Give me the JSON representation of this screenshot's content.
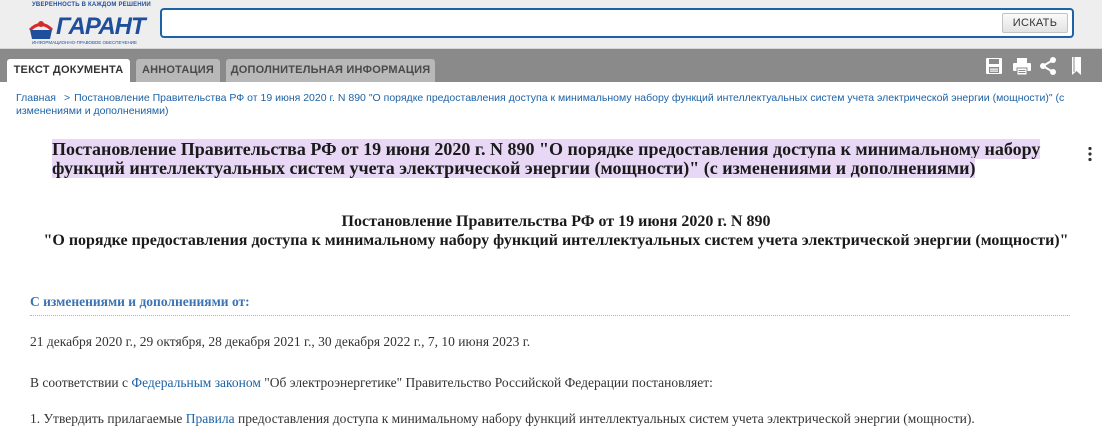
{
  "logo": {
    "tagline": "УВЕРЕННОСТЬ В КАЖДОМ РЕШЕНИИ",
    "wordmark": "ГАРАНТ",
    "subtitle": "ИНФОРМАЦИОННО-ПРАВОВОЕ ОБЕСПЕЧЕНИЕ"
  },
  "search": {
    "value": "",
    "placeholder": "",
    "button_label": "ИСКАТЬ"
  },
  "tabs": [
    {
      "label": "ТЕКСТ ДОКУМЕНТА",
      "active": true
    },
    {
      "label": "АННОТАЦИЯ",
      "active": false
    },
    {
      "label": "ДОПОЛНИТЕЛЬНАЯ ИНФОРМАЦИЯ",
      "active": false
    }
  ],
  "toolbar_icons": [
    "save-icon",
    "print-icon",
    "share-icon",
    "bookmark-icon"
  ],
  "breadcrumb": {
    "home": "Главная",
    "separator": ">",
    "current": "Постановление Правительства РФ от 19 июня 2020 г. N 890 \"О порядке предоставления доступа к минимальному набору функций интеллектуальных систем учета электрической энергии (мощности)\" (с изменениями и дополнениями)"
  },
  "document": {
    "title": "Постановление Правительства РФ от 19 июня 2020 г. N 890 \"О порядке предоставления доступа к минимальному набору функций интеллектуальных систем учета электрической энергии (мощности)\" (с изменениями и дополнениями)",
    "heading_line1": "Постановление Правительства РФ от 19 июня 2020 г. N 890",
    "heading_line2": "\"О порядке предоставления доступа к минимальному набору функций интеллектуальных систем учета электрической энергии (мощности)\"",
    "changes_label": "С изменениями и дополнениями от:",
    "change_dates": "21 декабря 2020 г., 29 октября, 28 декабря 2021 г., 30 декабря 2022 г., 7, 10 июня 2023 г.",
    "basis_prefix": "В соответствии с ",
    "basis_link": "Федеральным законом",
    "basis_suffix": " \"Об электроэнергетике\" Правительство Российской Федерации постановляет:",
    "item1_prefix": "1. Утвердить прилагаемые ",
    "item1_link": "Правила",
    "item1_suffix": " предоставления доступа к минимальному набору функций интеллектуальных систем учета электрической энергии (мощности)."
  },
  "colors": {
    "brand_blue": "#1d62a5",
    "logo_red": "#d62a2a",
    "title_highlight": "#e8d8f5",
    "tabbar_gray": "#8a8a8a"
  }
}
